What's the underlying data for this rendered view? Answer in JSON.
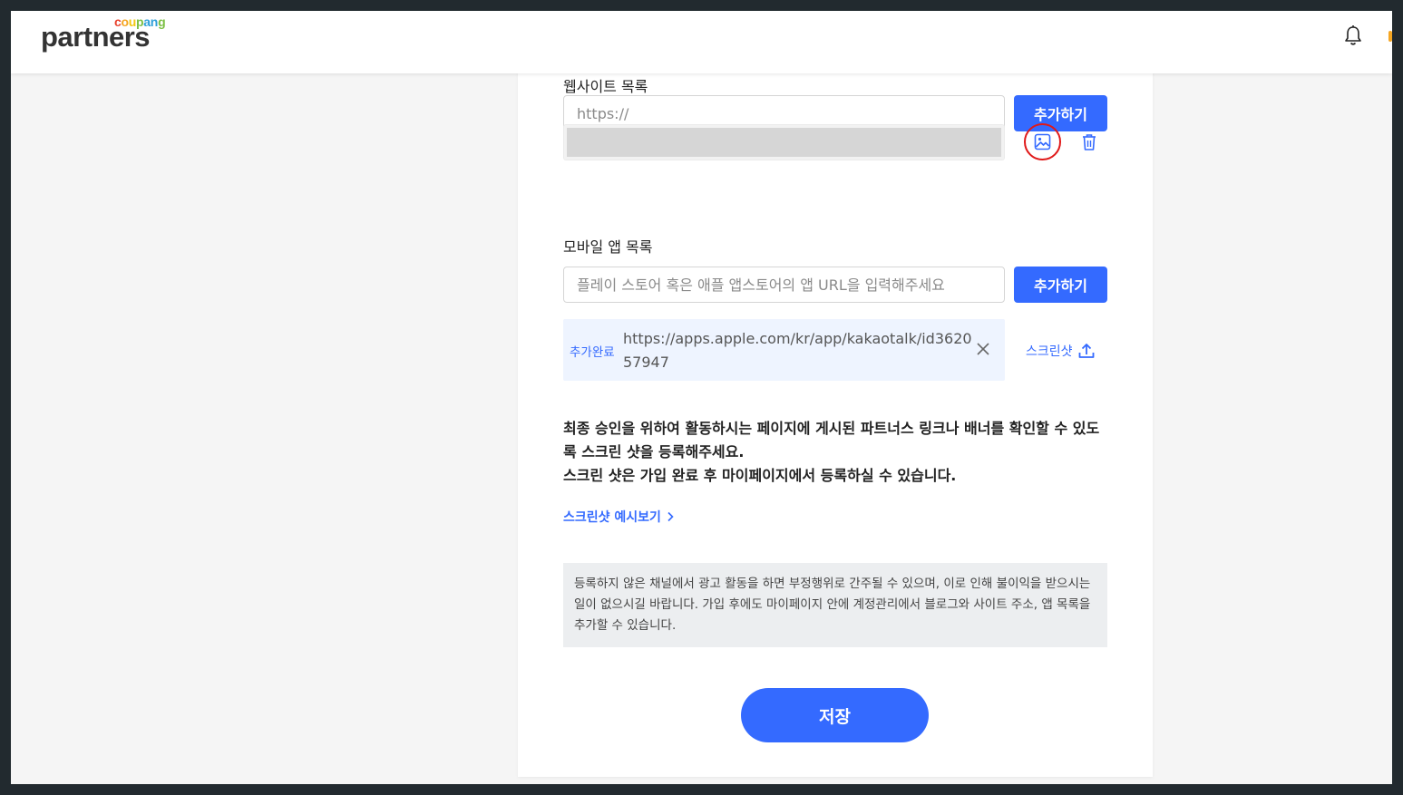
{
  "header": {
    "logo_top": "coupang",
    "logo_main": "partners"
  },
  "website_section": {
    "label": "웹사이트 목록",
    "input_placeholder": "https://",
    "add_button": "추가하기"
  },
  "mobile_section": {
    "label": "모바일 앱 목록",
    "input_placeholder": "플레이 스토어 혹은 애플 앱스토어의 앱 URL을 입력해주세요",
    "add_button": "추가하기",
    "app_item": {
      "status": "추가완료",
      "url": "https://apps.apple.com/kr/app/kakaotalk/id362057947",
      "screenshot_label": "스크린샷"
    }
  },
  "notice": {
    "line1": "최종 승인을 위하여 활동하시는 페이지에 게시된 파트너스 링크나 배너를 확인할 수 있도록 스크린 샷을 등록해주세요.",
    "line2": "스크린 샷은 가입 완료 후 마이페이지에서 등록하실 수 있습니다."
  },
  "example_link": "스크린샷 예시보기",
  "info_text": "등록하지 않은 채널에서 광고 활동을 하면 부정행위로 간주될 수 있으며, 이로 인해 불이익을 받으시는 일이 없으시길 바랍니다. 가입 후에도 마이페이지 안에 계정관리에서 블로그와 사이트 주소, 앱 목록을 추가할 수 있습니다.",
  "save_button": "저장",
  "colors": {
    "accent": "#346aff",
    "highlight_ring": "#e01919",
    "logo_c": "#e8412c",
    "logo_o": "#f5a623",
    "logo_u": "#f2c811",
    "logo_p": "#7bbf43",
    "logo_a": "#2d9fd9",
    "logo_n": "#2d9fd9",
    "logo_g": "#7bbf43"
  },
  "icons": {
    "notifications": "bell-icon",
    "image": "image-icon",
    "delete": "trash-icon",
    "remove": "close-icon",
    "upload": "upload-icon",
    "chevron": "chevron-right-icon"
  }
}
